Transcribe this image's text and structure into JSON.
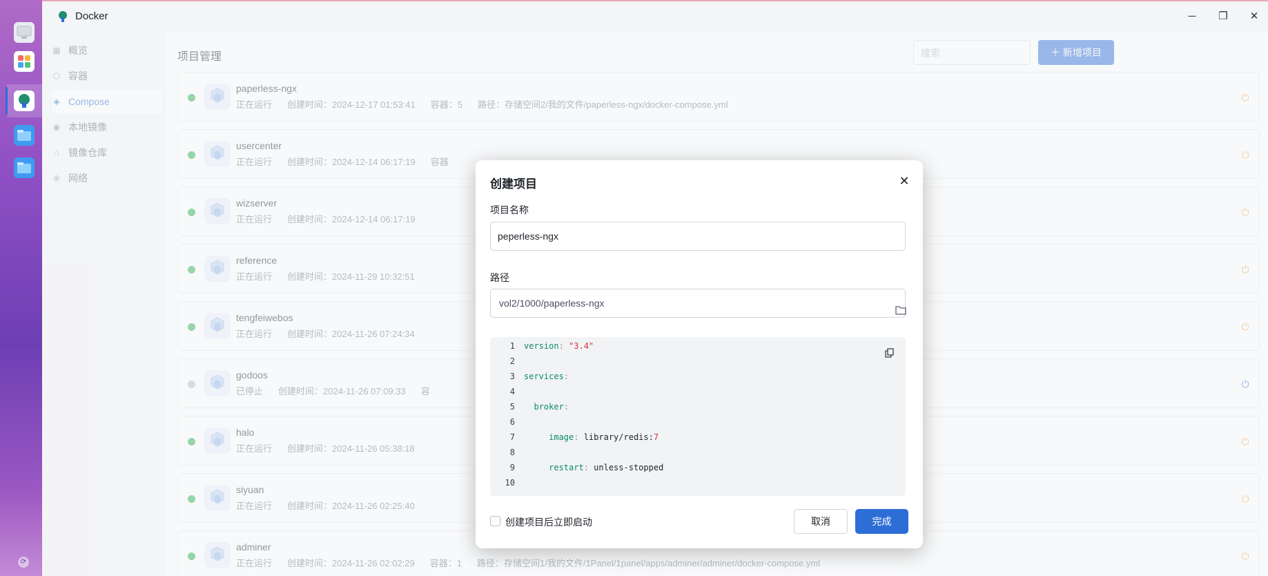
{
  "app": {
    "title": "Docker"
  },
  "window_controls": {
    "minimize": "─",
    "restore": "❐",
    "close": "✕"
  },
  "sidebar": {
    "items": [
      {
        "label": "概览",
        "icon": "grid-icon",
        "glyph": "▦",
        "active": false
      },
      {
        "label": "容器",
        "icon": "cube-icon",
        "glyph": "⬡",
        "active": false
      },
      {
        "label": "Compose",
        "icon": "layers-icon",
        "glyph": "◈",
        "active": true
      },
      {
        "label": "本地镜像",
        "icon": "disc-icon",
        "glyph": "◉",
        "active": false
      },
      {
        "label": "镜像仓库",
        "icon": "house-icon",
        "glyph": "⌂",
        "active": false
      },
      {
        "label": "网络",
        "icon": "globe-icon",
        "glyph": "⊕",
        "active": false
      }
    ]
  },
  "main": {
    "title": "项目管理",
    "search_placeholder": "搜索",
    "add_button": "＋ 新增项目"
  },
  "projects": [
    {
      "name": "paperless-ngx",
      "status": "正在运行",
      "created": "创建时间：2024-12-17 01:53:41",
      "containers": "容器：5",
      "path": "路径：存储空间2/我的文件/paperless-ngx/docker-compose.yml",
      "running": true
    },
    {
      "name": "usercenter",
      "status": "正在运行",
      "created": "创建时间：2024-12-14 06:17:19",
      "containers": "容器",
      "path": "",
      "running": true
    },
    {
      "name": "wizserver",
      "status": "正在运行",
      "created": "创建时间：2024-12-14 06:17:19",
      "containers": "",
      "path": "",
      "running": true
    },
    {
      "name": "reference",
      "status": "正在运行",
      "created": "创建时间：2024-11-29 10:32:51",
      "containers": "",
      "path": "",
      "running": true
    },
    {
      "name": "tengfeiwebos",
      "status": "正在运行",
      "created": "创建时间：2024-11-26 07:24:34",
      "containers": "",
      "path": "",
      "running": true
    },
    {
      "name": "godoos",
      "status": "已停止",
      "created": "创建时间：2024-11-26 07:09:33",
      "containers": "容",
      "path": "",
      "running": false
    },
    {
      "name": "halo",
      "status": "正在运行",
      "created": "创建时间：2024-11-26 05:38:18",
      "containers": "",
      "path": "",
      "running": true
    },
    {
      "name": "siyuan",
      "status": "正在运行",
      "created": "创建时间：2024-11-26 02:25:40",
      "containers": "",
      "path": "",
      "running": true
    },
    {
      "name": "adminer",
      "status": "正在运行",
      "created": "创建时间：2024-11-26 02:02:29",
      "containers": "容器：1",
      "path": "路径：存储空间1/我的文件/1Panel/1panel/apps/adminer/adminer/docker-compose.yml",
      "running": true
    }
  ],
  "modal": {
    "title": "创建项目",
    "name_label": "项目名称",
    "name_value": "peperless-ngx",
    "path_label": "路径",
    "path_value": "vol2/1000/paperless-ngx",
    "code_lines": [
      {
        "n": "1",
        "key": "version",
        "sep": ": ",
        "val": "\"3.4\"",
        "valtype": "str",
        "indent": ""
      },
      {
        "n": "2",
        "key": "",
        "sep": "",
        "val": "",
        "valtype": "plain",
        "indent": ""
      },
      {
        "n": "3",
        "key": "services",
        "sep": ":",
        "val": "",
        "valtype": "plain",
        "indent": ""
      },
      {
        "n": "4",
        "key": "",
        "sep": "",
        "val": "",
        "valtype": "plain",
        "indent": ""
      },
      {
        "n": "5",
        "key": "broker",
        "sep": ":",
        "val": "",
        "valtype": "plain",
        "indent": "  "
      },
      {
        "n": "6",
        "key": "",
        "sep": "",
        "val": "",
        "valtype": "plain",
        "indent": ""
      },
      {
        "n": "7",
        "key": "image",
        "sep": ": ",
        "val": "library/redis:",
        "val2": "7",
        "valtype": "plain",
        "indent": "     "
      },
      {
        "n": "8",
        "key": "",
        "sep": "",
        "val": "",
        "valtype": "plain",
        "indent": ""
      },
      {
        "n": "9",
        "key": "restart",
        "sep": ": ",
        "val": "unless-stopped",
        "valtype": "plain",
        "indent": "     "
      },
      {
        "n": "10",
        "key": "",
        "sep": "",
        "val": "",
        "valtype": "plain",
        "indent": ""
      }
    ],
    "autostart_label": "创建项目后立即启动",
    "cancel_label": "取消",
    "ok_label": "完成"
  }
}
